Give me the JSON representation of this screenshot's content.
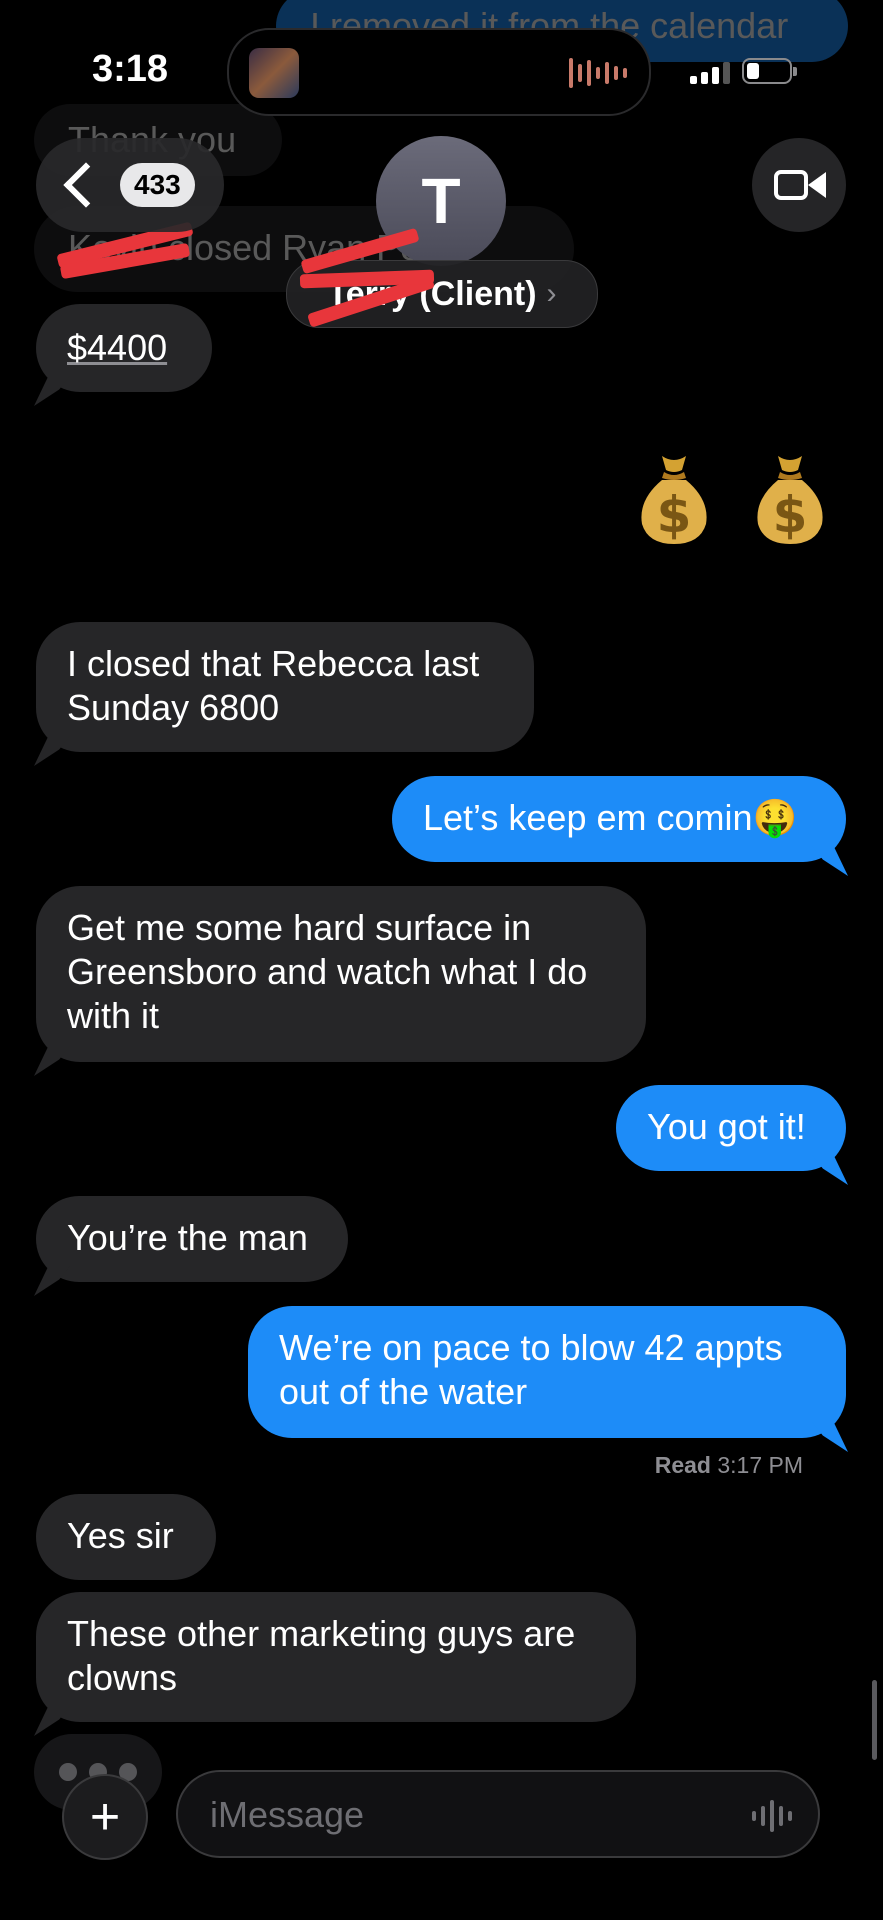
{
  "status_bar": {
    "time": "3:18"
  },
  "header": {
    "back_count": "433",
    "avatar_initial": "T",
    "contact_name": "Terry (Client)",
    "chevron": "›"
  },
  "faded_messages": {
    "top_out": "I removed it from the calendar",
    "thank_you": "Thank you",
    "kevin": "Kevin closed Ryan Perez",
    "amount": "$4400"
  },
  "emoji_row": {
    "emoji": "💰",
    "icon": "money-bag-icon"
  },
  "messages": [
    {
      "side": "in",
      "text": "I closed that Rebecca last Sunday 6800"
    },
    {
      "side": "out",
      "text": "Let’s keep em comin🤑"
    },
    {
      "side": "in",
      "text": "Get me some hard surface in Greensboro and watch what I do with it"
    },
    {
      "side": "out",
      "text": "You got it!"
    },
    {
      "side": "in",
      "text": "You’re the man"
    },
    {
      "side": "out",
      "text": "We’re on pace to blow 42 appts out of the water"
    },
    {
      "side": "in",
      "text": "Yes sir"
    },
    {
      "side": "in",
      "text": "These other marketing guys are clowns"
    }
  ],
  "read_receipt": {
    "label": "Read",
    "time": "3:17 PM"
  },
  "compose": {
    "plus": "+",
    "placeholder": "iMessage"
  },
  "colors": {
    "outgoing": "#1d8cf8",
    "incoming": "#262628",
    "redaction": "#e8363b"
  }
}
